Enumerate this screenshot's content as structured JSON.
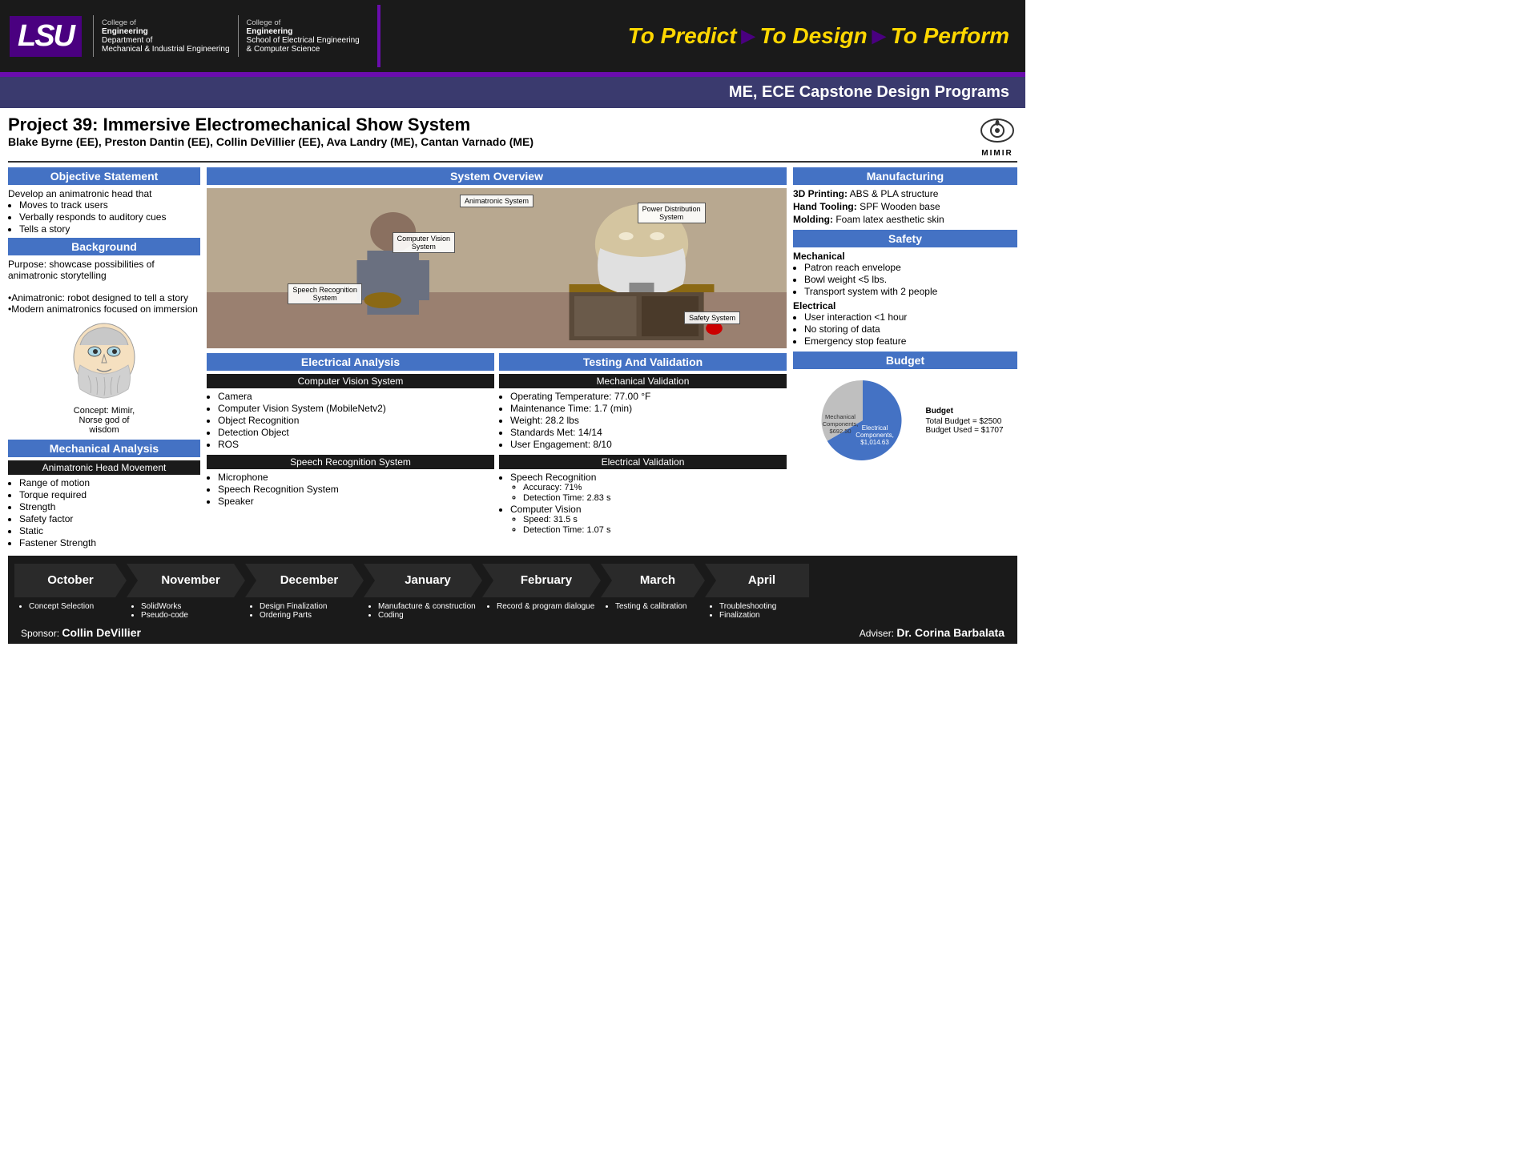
{
  "header": {
    "lsu": "LSU",
    "college1_line1": "College of",
    "college1_line2": "Engineering",
    "dept1": "Department of",
    "dept1_sub": "Mechanical & Industrial Engineering",
    "college2_line1": "College of",
    "college2_line2": "Engineering",
    "dept2": "School of Electrical Engineering",
    "dept2_sub": "& Computer Science",
    "tagline_predict": "To Predict",
    "tagline_design": "To Design",
    "tagline_perform": "To Perform",
    "arrow": "▶"
  },
  "subheader": "ME, ECE Capstone Design Programs",
  "project": {
    "title": "Project 39: Immersive Electromechanical Show System",
    "team": "Blake Byrne (EE), Preston Dantin (EE), Collin DeVillier (EE), Ava Landry (ME), Cantan Varnado (ME)"
  },
  "left": {
    "objective_header": "Objective Statement",
    "objective_text": "Develop an animatronic head that",
    "objective_bullets": [
      "Moves to track users",
      "Verbally responds to auditory cues",
      "Tells a story"
    ],
    "background_header": "Background",
    "background_text": "Purpose: showcase possibilities of animatronic storytelling",
    "background_extra": "•Animatronic: robot designed to tell a story\n•Modern animatronics focused on immersion",
    "concept_caption": "Concept: Mimir,\nNorse god of\nwisdom",
    "mech_header": "Mechanical Analysis",
    "mech_sub": "Animatronic Head Movement",
    "mech_bullets": [
      "Range of motion",
      "Torque required",
      "Strength",
      "Safety factor",
      "Static",
      "Fastener Strength"
    ]
  },
  "middle": {
    "system_header": "System Overview",
    "callouts": [
      "Animatronic System",
      "Computer Vision System",
      "Speech Recognition System",
      "Power Distribution System",
      "Safety System"
    ],
    "elec_header": "Electrical Analysis",
    "cvs_header": "Computer Vision System",
    "cvs_bullets": [
      "Camera",
      "Computer Vision System (MobileNetv2)",
      "Object Recognition",
      "Detection Object",
      "ROS"
    ],
    "speech_header": "Speech Recognition System",
    "speech_bullets": [
      "Microphone",
      "Speech Recognition System",
      "Speaker"
    ],
    "testing_header": "Testing And Validation",
    "mech_val_header": "Mechanical Validation",
    "mech_val_bullets": [
      "Operating Temperature: 77.00 °F",
      "Maintenance Time: 1.7 (min)",
      "Weight: 28.2 lbs",
      "Standards Met: 14/14",
      "User Engagement: 8/10"
    ],
    "elec_val_header": "Electrical Validation",
    "speech_acc": "Accuracy: 71%",
    "speech_det": "Detection Time: 2.83 s",
    "cv_speed": "Speed: 31.5 s",
    "cv_det": "Detection Time: 1.07 s"
  },
  "right": {
    "mfg_header": "Manufacturing",
    "mfg_3d": "3D Printing:",
    "mfg_3d_val": "ABS & PLA structure",
    "mfg_hand": "Hand Tooling:",
    "mfg_hand_val": "SPF Wooden base",
    "mfg_mold": "Molding:",
    "mfg_mold_val": "Foam latex aesthetic skin",
    "safety_header": "Safety",
    "safety_mech": "Mechanical",
    "safety_mech_bullets": [
      "Patron reach envelope",
      "Bowl weight <5 lbs.",
      "Transport system with 2 people"
    ],
    "safety_elec": "Electrical",
    "safety_elec_bullets": [
      "User interaction <1 hour",
      "No storing of data",
      "Emergency stop feature"
    ],
    "budget_header": "Budget",
    "budget_total": "Total Budget = $2500",
    "budget_used": "Budget Used = $1707",
    "mech_comp": "Mechanical Components, $692.50",
    "elec_comp": "Electrical Components, $1,014.63"
  },
  "timeline": {
    "months": [
      "October",
      "November",
      "December",
      "January",
      "February",
      "March",
      "April"
    ],
    "tasks": [
      [
        "Concept Selection"
      ],
      [
        "SolidWorks",
        "Pseudo-code"
      ],
      [
        "Design Finalization",
        "Ordering Parts"
      ],
      [
        "Manufacture & construction",
        "Coding"
      ],
      [
        "Record & program dialogue"
      ],
      [
        "Testing & calibration"
      ],
      [
        "Troubleshooting",
        "Finalization"
      ]
    ],
    "sponsor_label": "Sponsor:",
    "sponsor_name": "Collin DeVillier",
    "adviser_label": "Adviser:",
    "adviser_name": "Dr. Corina Barbalata"
  }
}
